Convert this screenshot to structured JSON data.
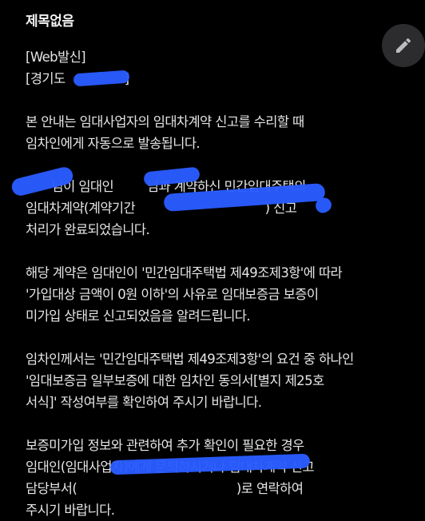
{
  "header": {
    "title": "제목없음"
  },
  "edit_button": {
    "icon": "pencil-icon"
  },
  "message": {
    "tag_line": "[Web발신]",
    "region_line": "[경기도",
    "region_line_end": "]",
    "p1": [
      "본 안내는 임대사업자의 임대차계약 신고를 수리할 때",
      "임차인에게 자동으로 발송됩니다."
    ],
    "p2": [
      "       님이 임대인         님과 계약하신 민간임대주택의",
      "임대차계약(계약기간                                   ) 신고",
      "처리가 완료되었습니다."
    ],
    "p3": [
      "해당 계약은 임대인이 '민간임대주택법 제49조제3항'에 따라",
      "'가입대상 금액이 0원 이하'의 사유로 임대보증금 보증이",
      "미가입 상태로 신고되었음을 알려드립니다."
    ],
    "p4": [
      "임차인께서는 '민간임대주택법 제49조제3항'의 요건 중 하나인",
      "'임대보증금 일부보증에 대한 임차인 동의서[별지 제25호",
      "서식]' 작성여부를 확인하여 주시기 바랍니다."
    ],
    "p5": [
      "보증미가입 정보와 관련하여 추가 확인이 필요한 경우",
      "임대인(임대사업자)에게 문의하시거나 임대차계약 신고",
      "담당부서(                                           )로 연락하여",
      "주시기 바랍니다."
    ]
  },
  "colors": {
    "background": "#000000",
    "text": "#e6e6e6",
    "redaction": "#2a5cff",
    "fab": "#2c2c2e"
  }
}
